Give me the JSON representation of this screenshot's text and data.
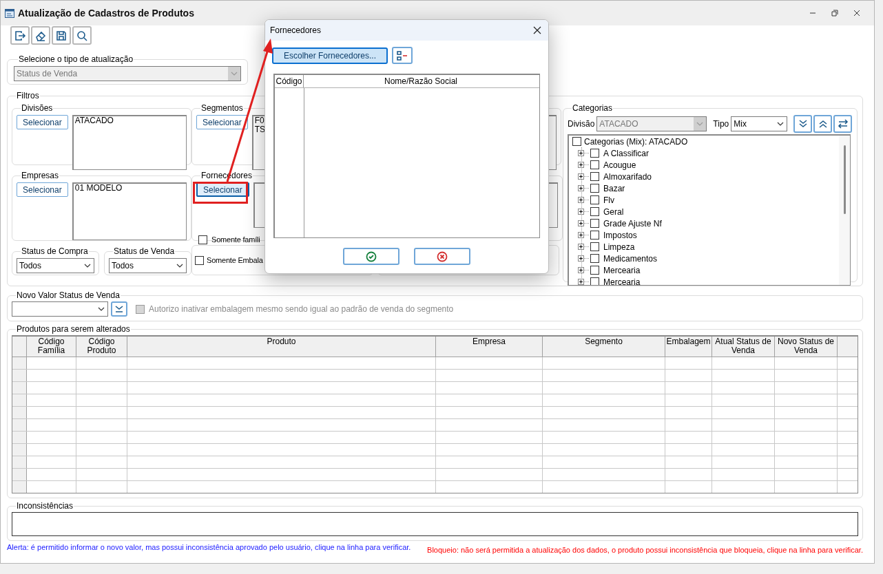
{
  "window": {
    "title": "Atualização de Cadastros de Produtos"
  },
  "update_type": {
    "label": "Selecione o tipo de atualização",
    "value": "Status de Venda",
    "disabled": true
  },
  "filters": {
    "label": "Filtros",
    "divisoes": {
      "label": "Divisões",
      "button": "Selecionar",
      "items": [
        "ATACADO"
      ]
    },
    "segmentos": {
      "label": "Segmentos",
      "button": "Selecionar",
      "items": [
        "F0",
        "TS"
      ]
    },
    "empresas": {
      "label": "Empresas",
      "button": "Selecionar",
      "items": [
        "01 MODELO"
      ]
    },
    "fornecedores": {
      "label": "Fornecedores",
      "button": "Selecionar",
      "highlighted": true,
      "checkbox": {
        "label": "Somente famíli",
        "checked": false
      }
    },
    "status_compra": {
      "label": "Status de Compra",
      "value": "Todos"
    },
    "status_venda": {
      "label": "Status de Venda",
      "value": "Todos"
    },
    "embalagem": {
      "label": "Somente Embala",
      "checked": false
    },
    "categorias": {
      "label": "Categorias",
      "divisao_label": "Divisão",
      "divisao": "ATACADO",
      "tipo_label": "Tipo",
      "tipo": "Mix",
      "tree": [
        {
          "label": "Categorias (Mix): ATACADO",
          "checked": false,
          "children": [
            {
              "label": "A Classificar",
              "checked": false,
              "expanded": false
            },
            {
              "label": "Acougue",
              "checked": false,
              "expanded": false
            },
            {
              "label": "Almoxarifado",
              "checked": false,
              "expanded": false
            },
            {
              "label": "Bazar",
              "checked": false,
              "expanded": false
            },
            {
              "label": "Flv",
              "checked": false,
              "expanded": false
            },
            {
              "label": "Geral",
              "checked": false,
              "expanded": false
            },
            {
              "label": "Grade Ajuste Nf",
              "checked": false,
              "expanded": false
            },
            {
              "label": "Impostos",
              "checked": false,
              "expanded": false
            },
            {
              "label": "Limpeza",
              "checked": false,
              "expanded": false
            },
            {
              "label": "Medicamentos",
              "checked": false,
              "expanded": false
            },
            {
              "label": "Mercearia",
              "checked": false,
              "expanded": false
            },
            {
              "label": "Mercearia",
              "checked": false,
              "expanded": false
            }
          ]
        }
      ]
    }
  },
  "new_value": {
    "label": "Novo Valor Status de Venda",
    "checkbox": {
      "label": "Autorizo inativar embalagem mesmo sendo igual ao padrão de venda do segmento",
      "checked": false,
      "disabled": true
    }
  },
  "products": {
    "label": "Produtos para serem alterados",
    "columns": [
      "Código Família",
      "Código Produto",
      "Produto",
      "Empresa",
      "Segmento",
      "Embalagem",
      "Atual Status de Venda",
      "Novo Status de Venda"
    ]
  },
  "inconsistencies": {
    "label": "Inconsistências"
  },
  "alerts": [
    {
      "kind": "alert",
      "text": "Alerta: é permitido informar o novo valor, mas possui inconsistência aprovado pelo usuário, clique na linha para verificar."
    },
    {
      "kind": "block",
      "text": "Bloqueio: não será permitida a atualização dos dados, o produto possui inconsistência que bloqueia, clique na linha para verificar."
    }
  ],
  "dialog": {
    "title": "Fornecedores",
    "choose_button": "Escolher Fornecedores...",
    "columns": [
      "Código",
      "Nome/Razão Social"
    ]
  }
}
